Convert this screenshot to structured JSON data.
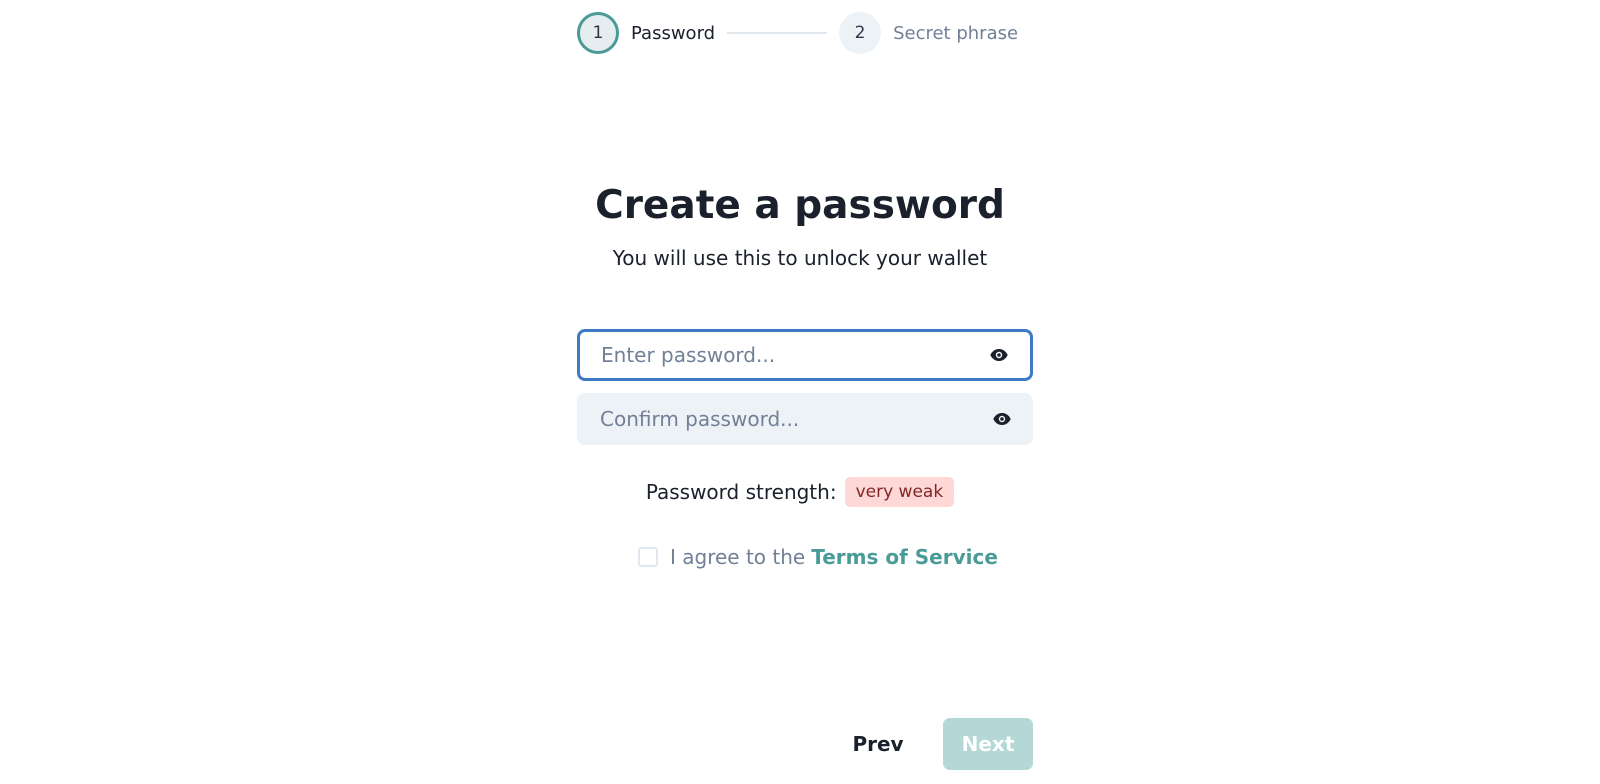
{
  "stepper": {
    "steps": [
      {
        "number": "1",
        "label": "Password",
        "state": "active"
      },
      {
        "number": "2",
        "label": "Secret phrase",
        "state": "inactive"
      }
    ]
  },
  "header": {
    "title": "Create a password",
    "subtitle": "You will use this to unlock your wallet"
  },
  "form": {
    "password_placeholder": "Enter password...",
    "password_value": "",
    "confirm_placeholder": "Confirm password...",
    "confirm_value": "",
    "eye_icon": "eye-icon"
  },
  "strength": {
    "label": "Password strength:",
    "value": "very weak",
    "badge_bg": "#fed7d7",
    "badge_color": "#822727"
  },
  "agreement": {
    "text": "I agree to the",
    "link": "Terms of Service",
    "checked": false
  },
  "buttons": {
    "prev": "Prev",
    "next": "Next",
    "next_disabled": true
  },
  "colors": {
    "accent": "#4a9b97",
    "focus": "#3f7bc4",
    "next_disabled_bg": "#b3d8d5"
  }
}
